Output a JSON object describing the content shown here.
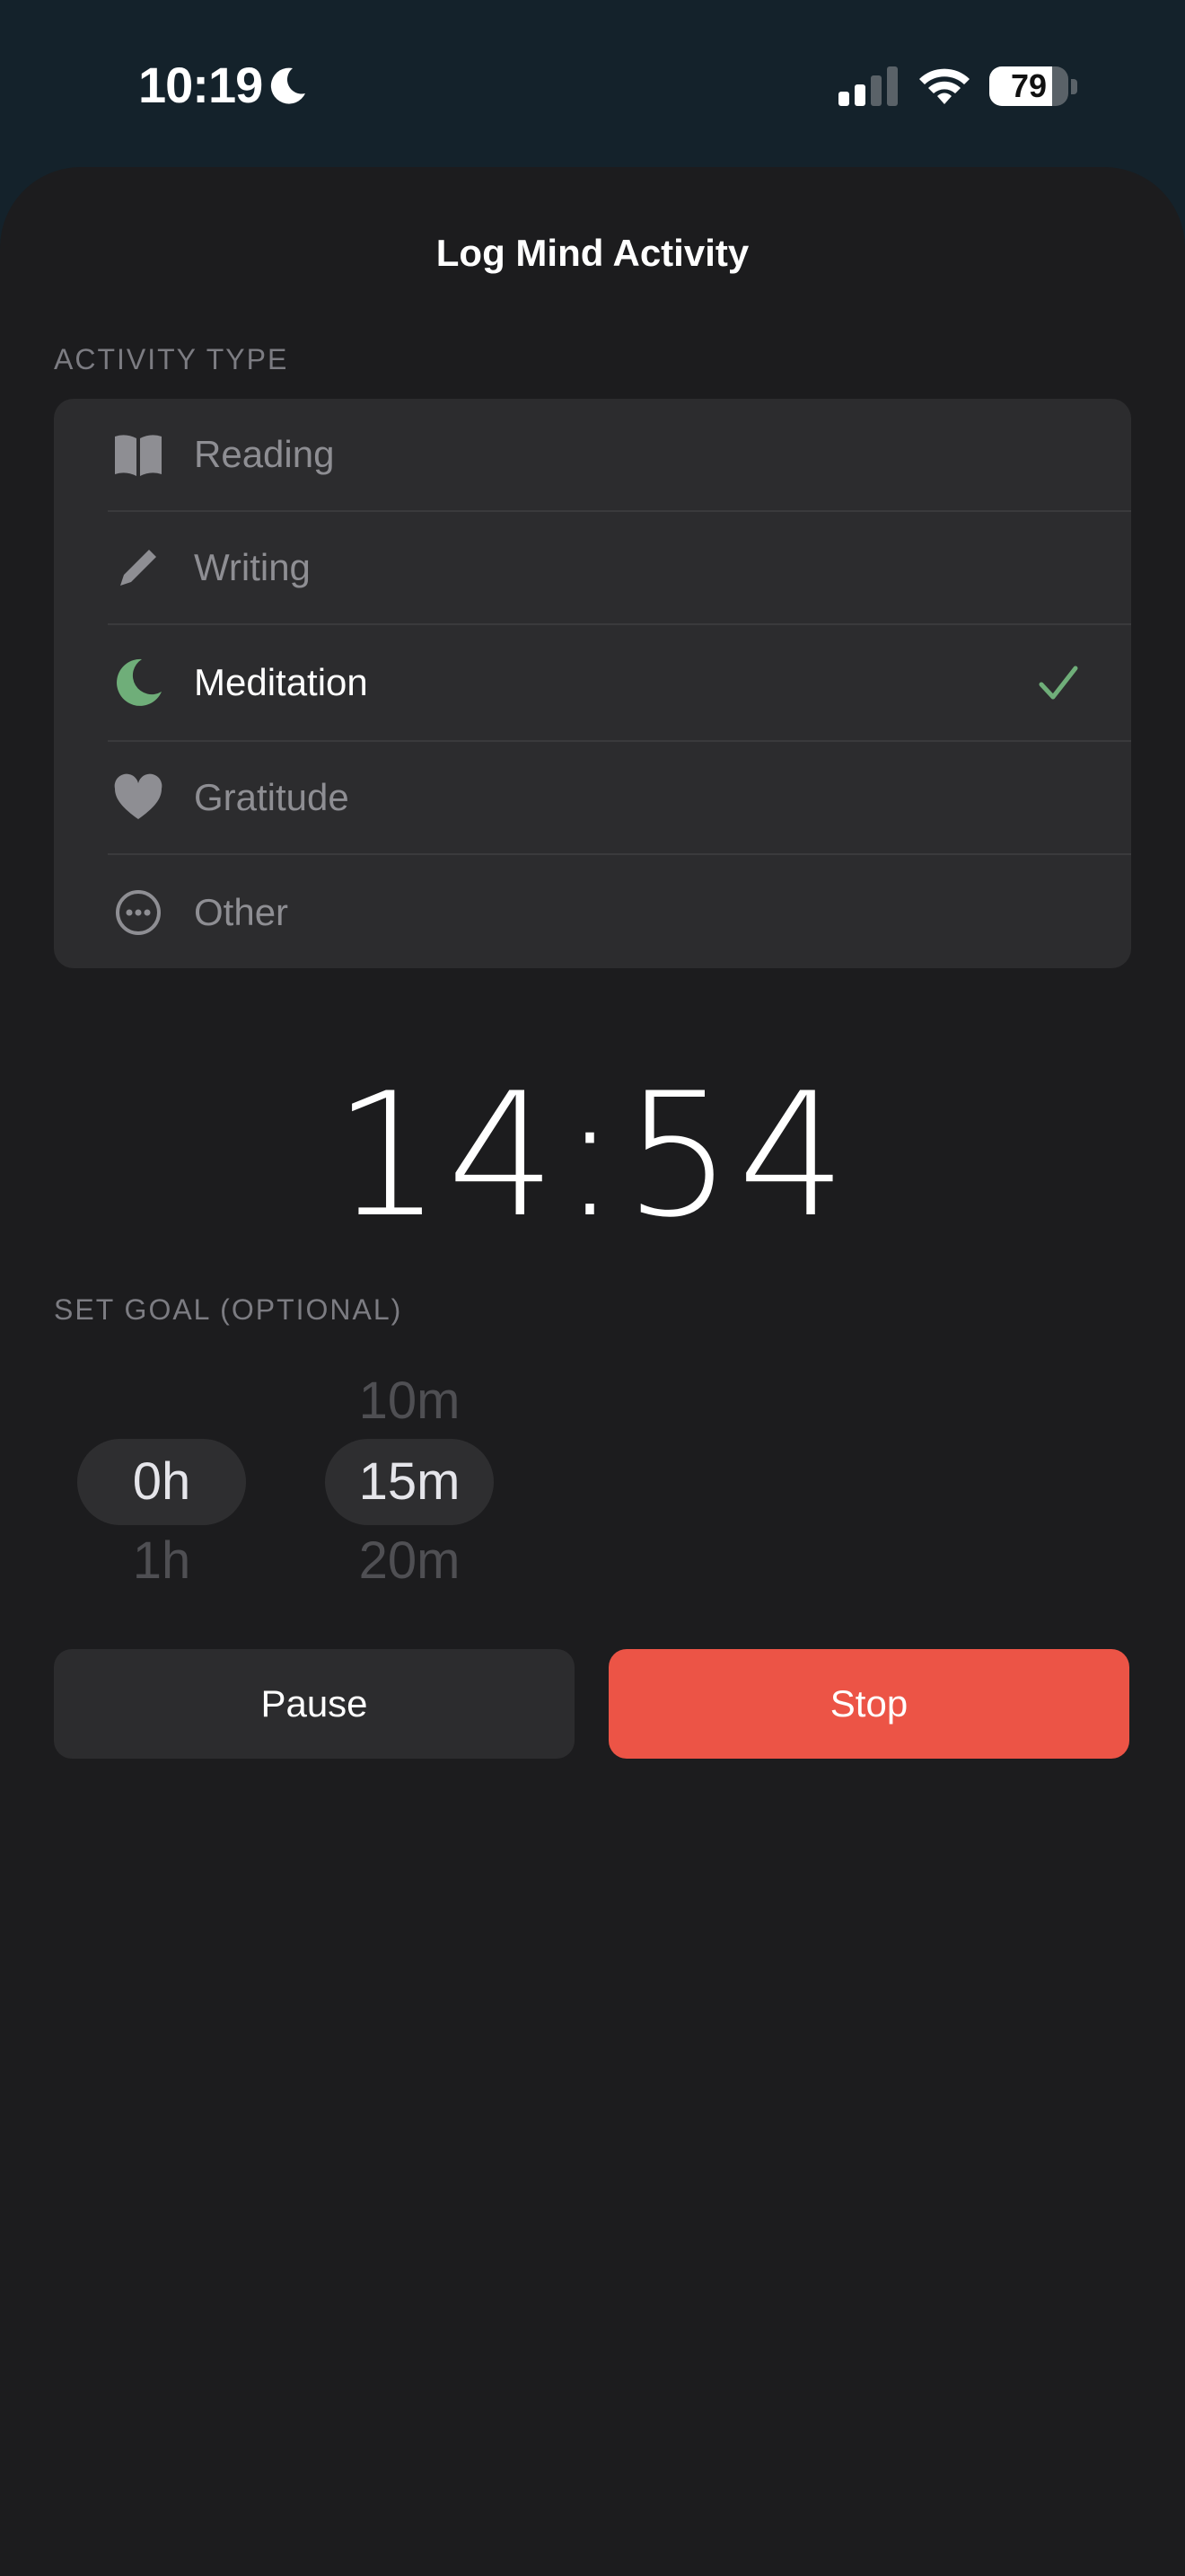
{
  "status_bar": {
    "time": "10:19",
    "battery": "79",
    "battery_fraction": 0.79
  },
  "sheet": {
    "title": "Log Mind Activity"
  },
  "activity_type": {
    "label": "ACTIVITY TYPE",
    "items": [
      {
        "label": "Reading",
        "icon": "book-icon",
        "selected": false
      },
      {
        "label": "Writing",
        "icon": "pencil-icon",
        "selected": false
      },
      {
        "label": "Meditation",
        "icon": "moon-icon",
        "selected": true
      },
      {
        "label": "Gratitude",
        "icon": "heart-icon",
        "selected": false
      },
      {
        "label": "Other",
        "icon": "ellipsis-circle-icon",
        "selected": false
      }
    ]
  },
  "timer": {
    "value": "14:54"
  },
  "goal": {
    "label": "SET GOAL (OPTIONAL)",
    "hours": {
      "above": "",
      "selected": "0h",
      "below": "1h"
    },
    "minutes": {
      "above": "10m",
      "selected": "15m",
      "below": "20m"
    }
  },
  "actions": {
    "pause_label": "Pause",
    "stop_label": "Stop"
  },
  "colors": {
    "accent_green": "#6fae79",
    "stop_red": "#ec5446",
    "background": "#1c1c1e",
    "card": "#2c2c2e"
  }
}
